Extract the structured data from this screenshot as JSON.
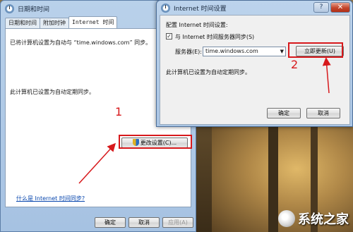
{
  "window1": {
    "title": "日期和时间",
    "tabs": [
      "日期和时间",
      "附加时钟",
      "Internet 时间"
    ],
    "sync_status": "已将计算机设置为自动与 “time.windows.com” 同步。",
    "auto_sync": "此计算机已设置为自动定期同步。",
    "change_settings_label": "更改设置(C)...",
    "help_link": "什么是 Internet 时间同步?",
    "ok_label": "确定",
    "cancel_label": "取消",
    "apply_label": "应用(A)"
  },
  "window2": {
    "title": "Internet 时间设置",
    "config_label": "配置 Internet 时间设置:",
    "sync_checkbox_label": "与 Internet 时间服务器同步(S)",
    "sync_checked": true,
    "server_label": "服务器(E):",
    "server_value": "time.windows.com",
    "update_now_label": "立即更新(U)",
    "status_text": "此计算机已设置为自动定期同步。",
    "ok_label": "确定",
    "cancel_label": "取消",
    "help_label": "?",
    "close_label": "✕"
  },
  "annotations": {
    "step1": "1",
    "step2": "2",
    "color": "#d7191c"
  },
  "watermark": {
    "text": "系统之家"
  }
}
